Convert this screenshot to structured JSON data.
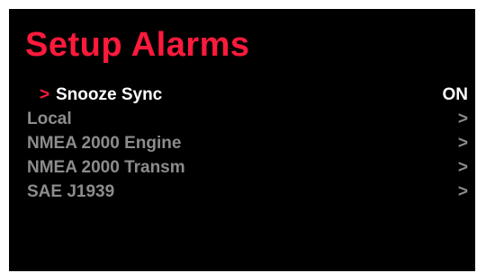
{
  "screen": {
    "title": "Setup Alarms",
    "accent_color": "#ff1a3c",
    "background_color": "#000000",
    "selected_text_color": "#ffffff",
    "item_text_color": "#8c8c8c"
  },
  "menu": {
    "selection_marker": ">",
    "items": [
      {
        "label": "Snooze Sync",
        "value": "ON",
        "selected": true
      },
      {
        "label": "Local",
        "value": ">",
        "selected": false
      },
      {
        "label": "NMEA 2000 Engine",
        "value": ">",
        "selected": false
      },
      {
        "label": "NMEA 2000 Transm",
        "value": ">",
        "selected": false
      },
      {
        "label": "SAE J1939",
        "value": ">",
        "selected": false
      }
    ]
  }
}
